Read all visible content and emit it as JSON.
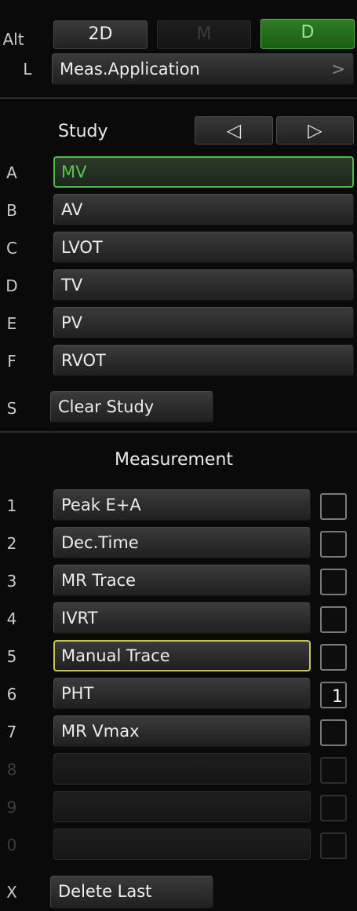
{
  "mode": {
    "alt_label": "Alt",
    "buttons": [
      {
        "label": "2D",
        "state": "normal"
      },
      {
        "label": "M",
        "state": "disabled"
      },
      {
        "label": "D",
        "state": "active"
      }
    ]
  },
  "application": {
    "key": "L",
    "label": "Meas.Application",
    "chevron": ">"
  },
  "study": {
    "heading": "Study",
    "prev_icon": "◁",
    "next_icon": "▷",
    "items": [
      {
        "key": "A",
        "label": "MV",
        "selected": true
      },
      {
        "key": "B",
        "label": "AV"
      },
      {
        "key": "C",
        "label": "LVOT"
      },
      {
        "key": "D",
        "label": "TV"
      },
      {
        "key": "E",
        "label": "PV"
      },
      {
        "key": "F",
        "label": "RVOT"
      }
    ],
    "clear": {
      "key": "S",
      "label": "Clear Study"
    }
  },
  "measurement": {
    "heading": "Measurement",
    "items": [
      {
        "key": "1",
        "label": "Peak E+A",
        "count": ""
      },
      {
        "key": "2",
        "label": "Dec.Time",
        "count": ""
      },
      {
        "key": "3",
        "label": "MR Trace",
        "count": ""
      },
      {
        "key": "4",
        "label": "IVRT",
        "count": ""
      },
      {
        "key": "5",
        "label": "Manual Trace",
        "count": "",
        "focused": true
      },
      {
        "key": "6",
        "label": "PHT",
        "count": "1"
      },
      {
        "key": "7",
        "label": "MR Vmax",
        "count": ""
      },
      {
        "key": "8",
        "label": "",
        "count": "",
        "disabled": true
      },
      {
        "key": "9",
        "label": "",
        "count": "",
        "disabled": true
      },
      {
        "key": "0",
        "label": "",
        "count": "",
        "disabled": true
      }
    ],
    "delete": {
      "key": "X",
      "label": "Delete Last"
    }
  },
  "colors": {
    "accent_green": "#4fb84a",
    "focus_yellow": "#c9c35a",
    "background": "#0a0a0a"
  }
}
